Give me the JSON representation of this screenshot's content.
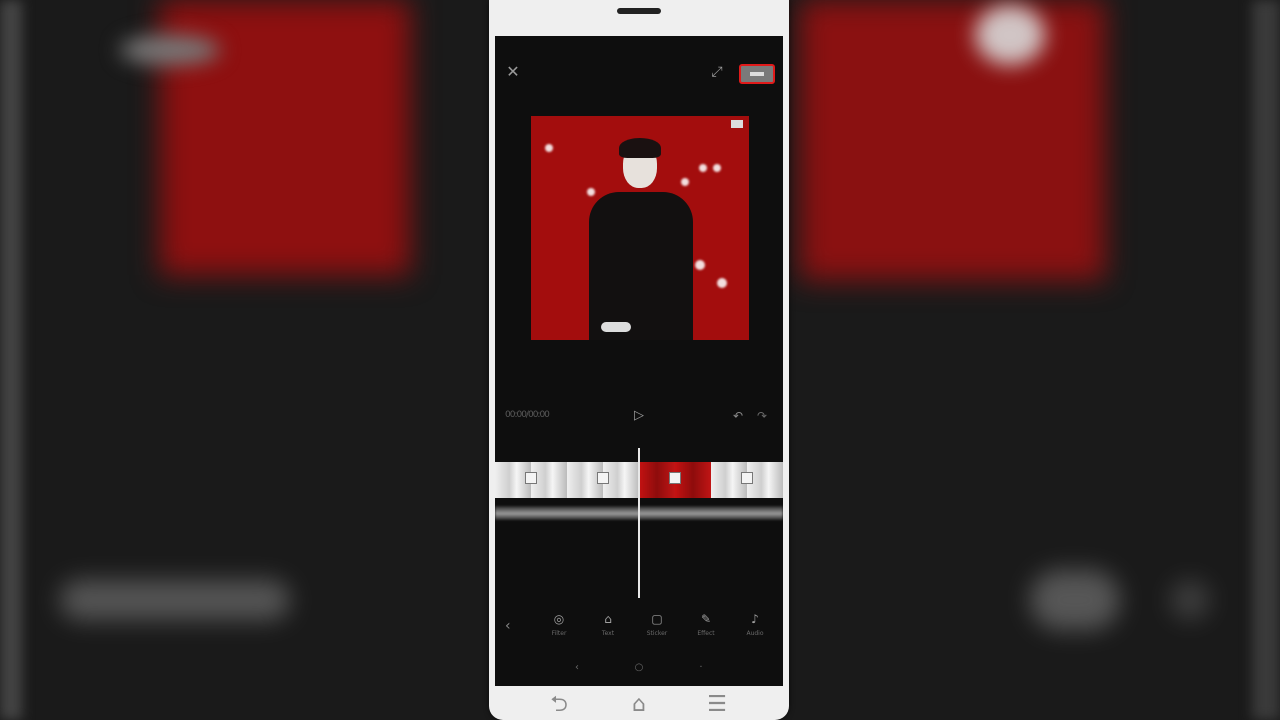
{
  "app": {
    "topbar": {
      "close_icon": "close-icon",
      "expand_icon": "expand-icon",
      "export_icon": "export-icon",
      "accent_color": "#e01a1a"
    },
    "playback": {
      "time": "00:00/00:00",
      "play_icon": "play-icon",
      "undo_icon": "undo-icon",
      "redo_icon": "redo-icon"
    },
    "timeline": {
      "clips": [
        "light",
        "light",
        "light",
        "light",
        "red",
        "red",
        "light",
        "light"
      ],
      "playhead_fraction": 0.5
    },
    "toolbar": {
      "back_icon": "chevron-left-icon",
      "tools": [
        {
          "name": "filter",
          "icon": "filter-icon",
          "label": "Filter"
        },
        {
          "name": "text",
          "icon": "text-icon",
          "label": "Text"
        },
        {
          "name": "sticker",
          "icon": "sticker-icon",
          "label": "Sticker"
        },
        {
          "name": "effect",
          "icon": "effect-icon",
          "label": "Effect"
        },
        {
          "name": "audio",
          "icon": "audio-icon",
          "label": "Audio"
        }
      ]
    },
    "device_nav": {
      "back_icon": "back-icon",
      "home_icon": "home-icon",
      "menu_icon": "menu-icon"
    }
  }
}
